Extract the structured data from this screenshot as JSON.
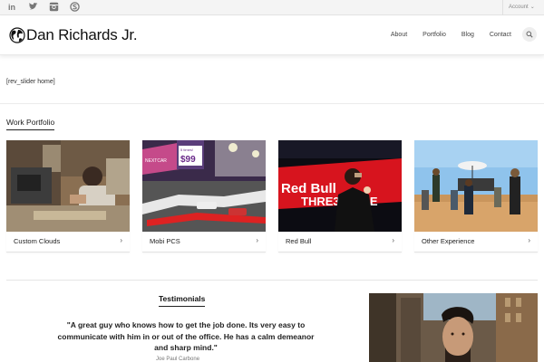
{
  "topbar": {
    "social": [
      {
        "icon": "linkedin-icon",
        "label": "in"
      },
      {
        "icon": "twitter-icon"
      },
      {
        "icon": "instagram-icon"
      },
      {
        "icon": "skype-icon"
      }
    ],
    "account_label": "Account"
  },
  "header": {
    "site_title": "Dan Richards Jr.",
    "nav": [
      "About",
      "Portfolio",
      "Blog",
      "Contact"
    ],
    "search_icon": "search-icon"
  },
  "main": {
    "shortcode_text": "[rev_slider home]",
    "portfolio_title": "Work Portfolio",
    "portfolio": [
      {
        "title": "Custom Clouds",
        "arrow": "›"
      },
      {
        "title": "Mobi PCS",
        "arrow": "›"
      },
      {
        "title": "Red Bull",
        "arrow": "›"
      },
      {
        "title": "Other Experience",
        "arrow": "›"
      }
    ],
    "thumb_texts": {
      "mobi_price": "$99",
      "mobi_sign": "5 times!",
      "mobi_banner": "NEXTCAR",
      "redbull_line1": "Red Bull",
      "redbull_line2": "THRE3STYLE"
    }
  },
  "testimonials": {
    "title": "Testimonials",
    "quote": "\"A great guy who knows how to get the job done. Its very easy to communicate with him in or out of the office.  He has a calm demeanor and sharp mind.\"",
    "author": "Joe Paul Carbone"
  },
  "colors": {
    "topbar_bg": "#f4f4f4",
    "text": "#333333",
    "accent_red": "#d7141e"
  }
}
